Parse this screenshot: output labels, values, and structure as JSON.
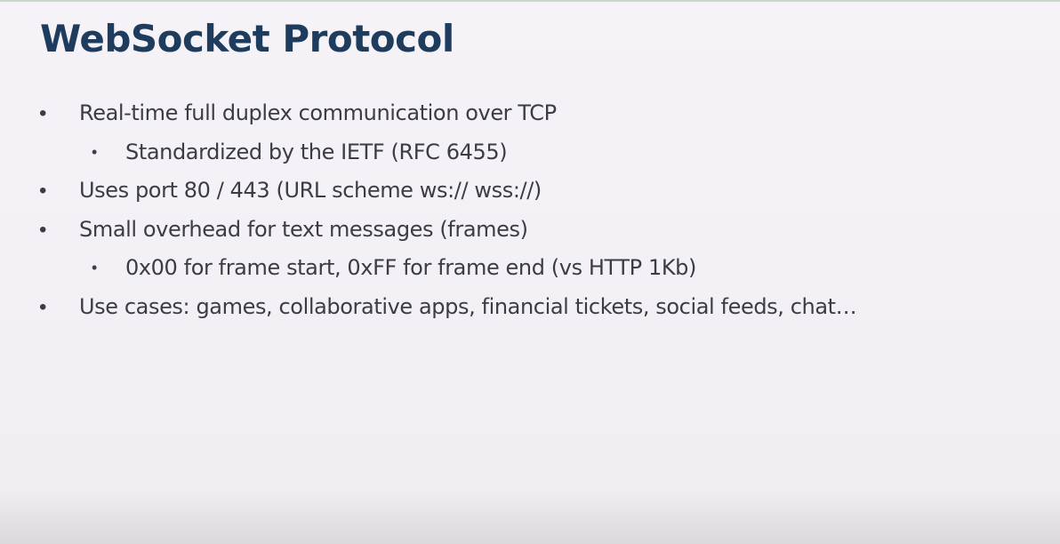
{
  "slide": {
    "title": "WebSocket Protocol",
    "bullets": [
      {
        "level": 1,
        "text": "Real-time full duplex communication over TCP"
      },
      {
        "level": 2,
        "text": "Standardized by the IETF (RFC 6455)"
      },
      {
        "level": 1,
        "text": "Uses port 80 / 443 (URL scheme ws:// wss://)"
      },
      {
        "level": 1,
        "text": "Small overhead for text messages (frames)"
      },
      {
        "level": 2,
        "text": "0x00 for frame start, 0xFF for frame end (vs HTTP 1Kb)"
      },
      {
        "level": 1,
        "text": "Use cases: games, collaborative apps, financial tickets, social feeds, chat…"
      }
    ],
    "bullet_glyph": "•"
  },
  "colors": {
    "title": "#1e3c5e",
    "body_text": "#3c3c44",
    "background": "#f3f1f5"
  }
}
